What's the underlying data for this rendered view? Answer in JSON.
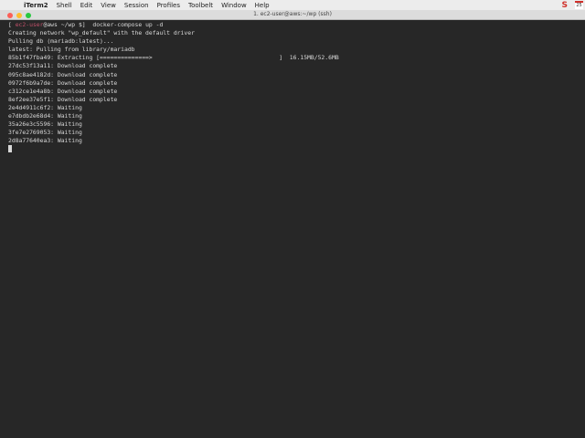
{
  "menubar": {
    "app": "iTerm2",
    "items": [
      "Shell",
      "Edit",
      "View",
      "Session",
      "Profiles",
      "Toolbelt",
      "Window",
      "Help"
    ],
    "status_s": "S",
    "calendar": "25"
  },
  "window": {
    "title": "1. ec2-user@aws:~/wp (ssh)"
  },
  "terminal": {
    "prompt": {
      "open": "[ ",
      "user": "ec2-user",
      "host": "@aws ~/wp $]",
      "command": "  docker-compose up -d"
    },
    "lines": [
      "Creating network \"wp_default\" with the default driver",
      "Pulling db (mariadb:latest)...",
      "latest: Pulling from library/mariadb",
      "85b1f47fba49: Extracting [==============>                                    ]  16.15MB/52.6MB",
      "27dc53f13a11: Download complete",
      "095c8ae4182d: Download complete",
      "0972f6b9a7de: Download complete",
      "c312ce1e4a8b: Download complete",
      "8ef2ee37e5f1: Download complete",
      "2e4d4911c6f2: Waiting",
      "e7dbdb2e68d4: Waiting",
      "35a26e3c5596: Waiting",
      "3fe7e2769053: Waiting",
      "2d8a77640ea3: Waiting"
    ],
    "extract_progress": 0.31
  },
  "colors": {
    "user": "#c0506a",
    "background": "#272727"
  }
}
